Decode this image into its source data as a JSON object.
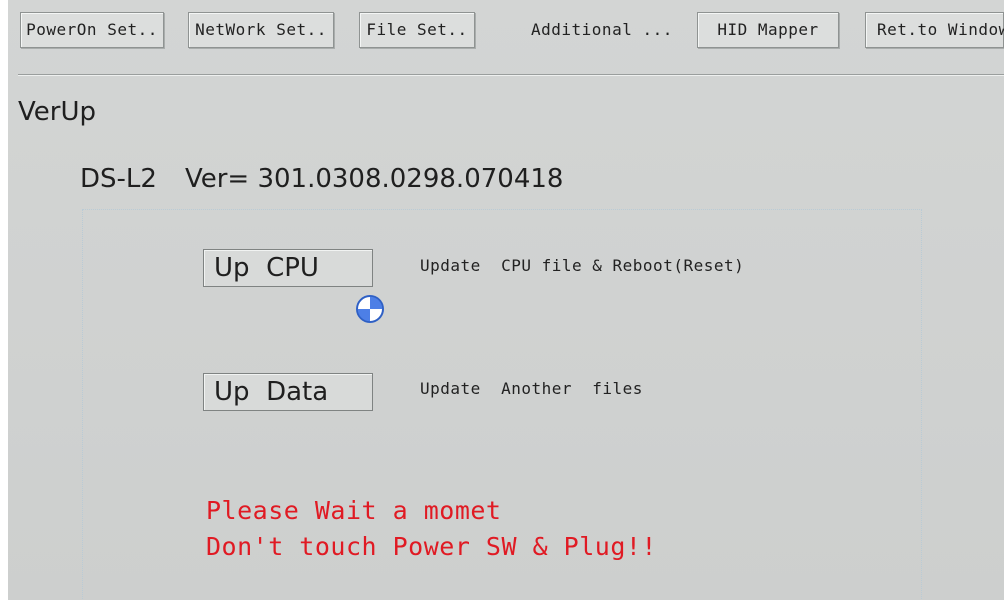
{
  "tabs": [
    {
      "label": "PowerOn Set.."
    },
    {
      "label": "NetWork Set.."
    },
    {
      "label": "File Set.."
    },
    {
      "label": "Additional ..."
    },
    {
      "label": "HID Mapper"
    },
    {
      "label": "Ret.to Window"
    }
  ],
  "section": {
    "title": "VerUp"
  },
  "device": {
    "model": "DS-L2",
    "version": "Ver= 301.0308.0298.070418"
  },
  "actions": {
    "update_cpu": {
      "label": "Up  CPU",
      "description": "Update  CPU file & Reboot(Reset)"
    },
    "update_data": {
      "label": "Up  Data",
      "description": "Update  Another  files"
    }
  },
  "status": {
    "line1": "Please Wait a momet",
    "line2": "Don't touch Power SW & Plug!!",
    "color": "#e01a23"
  },
  "icons": {
    "busy": "wait-cursor-icon"
  }
}
